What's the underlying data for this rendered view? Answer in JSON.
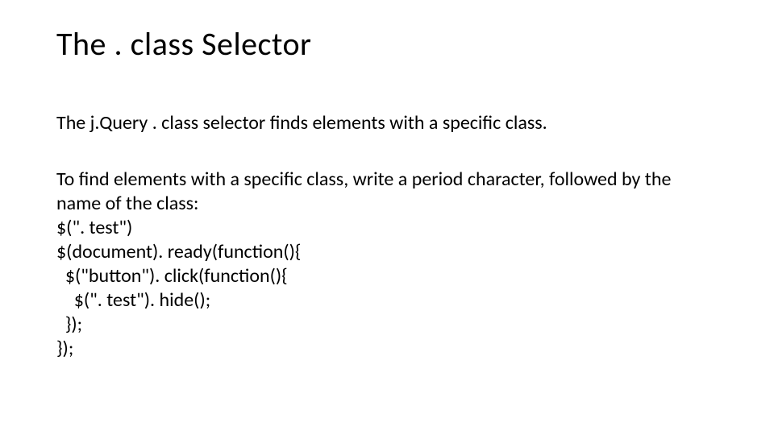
{
  "title": "The . class Selector",
  "para1": "The j.Query . class selector finds elements with a specific class.",
  "para2": "To find elements with a specific class, write a period character, followed by the name of the class:",
  "code": {
    "line1": "$(\". test\")",
    "line2": "$(document). ready(function(){",
    "line3": "  $(\"button\"). click(function(){",
    "line4": "    $(\". test\"). hide();",
    "line5": "  });",
    "line6": "});"
  }
}
